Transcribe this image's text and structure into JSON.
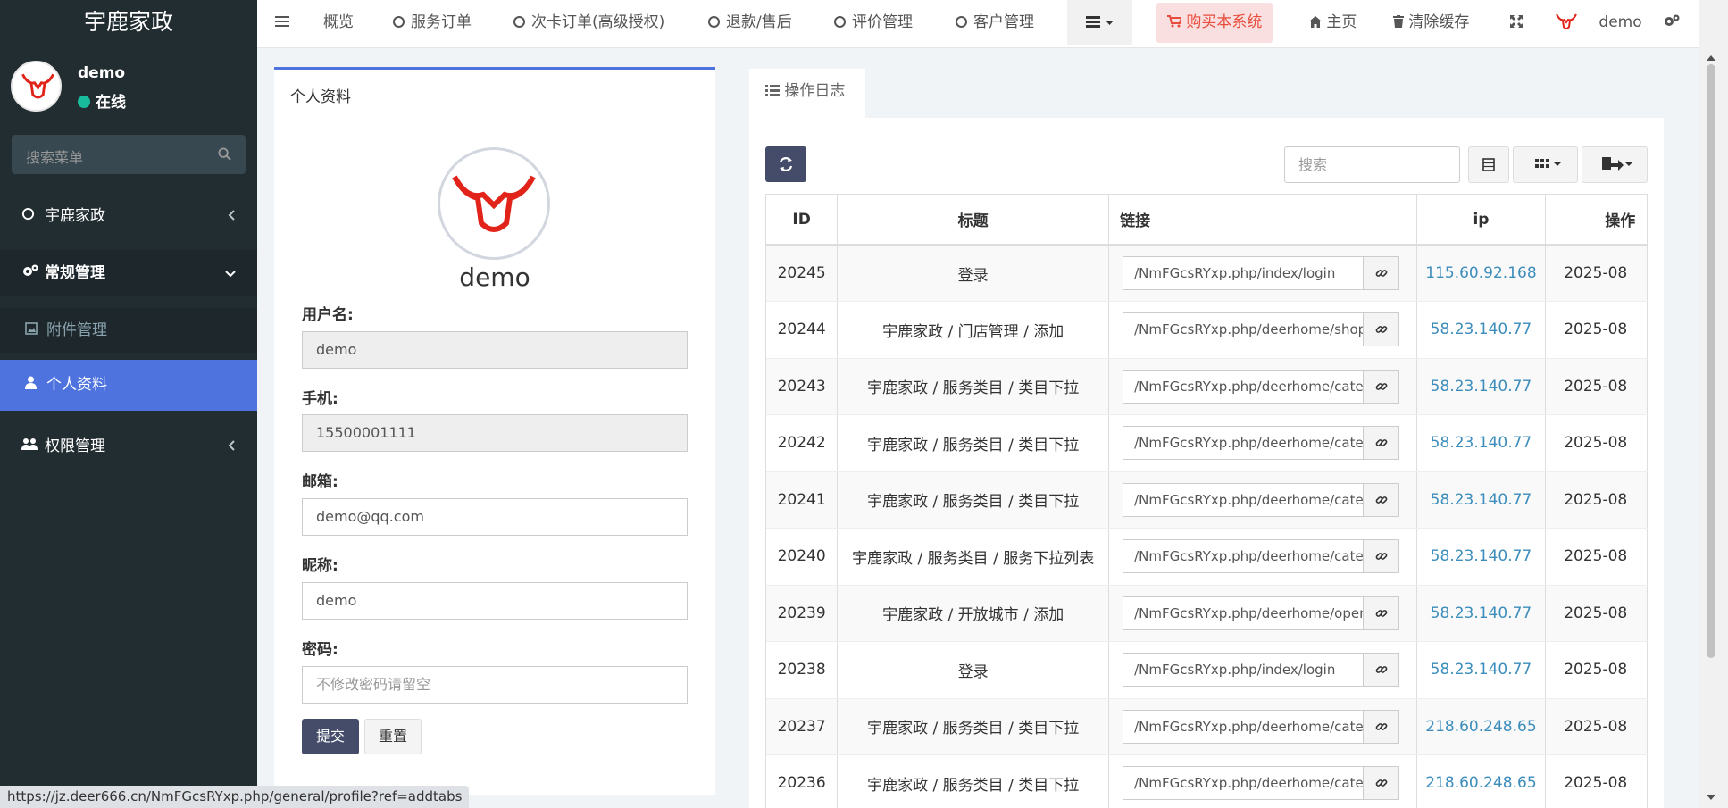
{
  "brand": "宇鹿家政",
  "user": {
    "name": "demo",
    "status": "在线"
  },
  "sidebar": {
    "search_placeholder": "搜索菜单",
    "items": [
      {
        "label": "宇鹿家政",
        "icon": "circle-icon"
      },
      {
        "label": "常规管理",
        "icon": "gears-icon"
      },
      {
        "label": "附件管理",
        "icon": "image-icon"
      },
      {
        "label": "个人资料",
        "icon": "user-icon"
      },
      {
        "label": "权限管理",
        "icon": "users-icon"
      }
    ]
  },
  "topnav": {
    "items": [
      "概览",
      "服务订单",
      "次卡订单(高级授权)",
      "退款/售后",
      "评价管理",
      "客户管理"
    ],
    "buy": "购买本系统",
    "home": "主页",
    "clear_cache": "清除缓存",
    "user": "demo"
  },
  "profile": {
    "title": "个人资料",
    "name": "demo",
    "username_label": "用户名:",
    "username": "demo",
    "phone_label": "手机:",
    "phone": "15500001111",
    "email_label": "邮箱:",
    "email": "demo@qq.com",
    "nickname_label": "昵称:",
    "nickname": "demo",
    "password_label": "密码:",
    "password_placeholder": "不修改密码请留空",
    "submit": "提交",
    "reset": "重置"
  },
  "log": {
    "tab": "操作日志",
    "search_placeholder": "搜索",
    "columns": [
      "ID",
      "标题",
      "链接",
      "ip",
      "操作"
    ],
    "rows": [
      {
        "id": "20245",
        "title": "登录",
        "url": "/NmFGcsRYxp.php/index/login",
        "ip": "115.60.92.168",
        "time": "2025-08"
      },
      {
        "id": "20244",
        "title": "宇鹿家政 / 门店管理 / 添加",
        "url": "/NmFGcsRYxp.php/deerhome/shop/a",
        "ip": "58.23.140.77",
        "time": "2025-08"
      },
      {
        "id": "20243",
        "title": "宇鹿家政 / 服务类目 / 类目下拉",
        "url": "/NmFGcsRYxp.php/deerhome/cate/s",
        "ip": "58.23.140.77",
        "time": "2025-08"
      },
      {
        "id": "20242",
        "title": "宇鹿家政 / 服务类目 / 类目下拉",
        "url": "/NmFGcsRYxp.php/deerhome/cate/s",
        "ip": "58.23.140.77",
        "time": "2025-08"
      },
      {
        "id": "20241",
        "title": "宇鹿家政 / 服务类目 / 类目下拉",
        "url": "/NmFGcsRYxp.php/deerhome/cate/s",
        "ip": "58.23.140.77",
        "time": "2025-08"
      },
      {
        "id": "20240",
        "title": "宇鹿家政 / 服务类目 / 服务下拉列表",
        "url": "/NmFGcsRYxp.php/deerhome/cate/c",
        "ip": "58.23.140.77",
        "time": "2025-08"
      },
      {
        "id": "20239",
        "title": "宇鹿家政 / 开放城市 / 添加",
        "url": "/NmFGcsRYxp.php/deerhome/open_",
        "ip": "58.23.140.77",
        "time": "2025-08"
      },
      {
        "id": "20238",
        "title": "登录",
        "url": "/NmFGcsRYxp.php/index/login",
        "ip": "58.23.140.77",
        "time": "2025-08"
      },
      {
        "id": "20237",
        "title": "宇鹿家政 / 服务类目 / 类目下拉",
        "url": "/NmFGcsRYxp.php/deerhome/cate/s",
        "ip": "218.60.248.65",
        "time": "2025-08"
      },
      {
        "id": "20236",
        "title": "宇鹿家政 / 服务类目 / 类目下拉",
        "url": "/NmFGcsRYxp.php/deerhome/cate/s",
        "ip": "218.60.248.65",
        "time": "2025-08"
      }
    ]
  },
  "status_url": "https://jz.deer666.cn/NmFGcsRYxp.php/general/profile?ref=addtabs",
  "colors": {
    "sidebar": "#222d32",
    "accent": "#4e73df",
    "primary_button": "#444c69",
    "online": "#18bc9c",
    "link": "#3c8dbc",
    "buy": "#e74c3c"
  }
}
